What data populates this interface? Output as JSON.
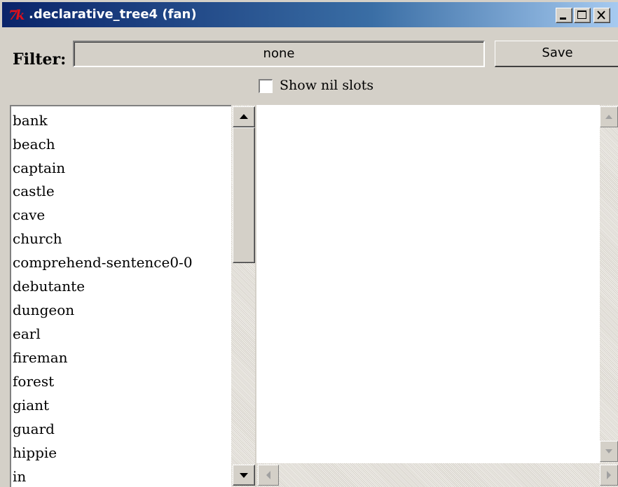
{
  "window": {
    "title": ".declarative_tree4 (fan)",
    "logo_text": "7k"
  },
  "filter": {
    "label": "Filter:",
    "value": "none"
  },
  "save_label": "Save",
  "show_nil_slots": {
    "label": "Show nil slots",
    "checked": false
  },
  "list": {
    "items": [
      "bank",
      "beach",
      "captain",
      "castle",
      "cave",
      "church",
      "comprehend-sentence0-0",
      "debutante",
      "dungeon",
      "earl",
      "fireman",
      "forest",
      "giant",
      "guard",
      "hippie",
      "in"
    ]
  }
}
